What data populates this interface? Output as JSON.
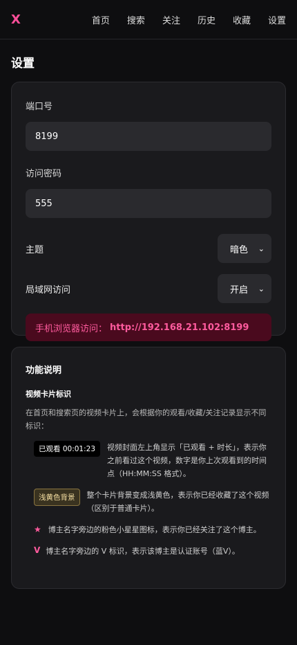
{
  "header": {
    "logo": "X",
    "nav": [
      "首页",
      "搜索",
      "关注",
      "历史",
      "收藏",
      "设置"
    ]
  },
  "page": {
    "title": "设置"
  },
  "settings": {
    "port_label": "端口号",
    "port_value": "8199",
    "password_label": "访问密码",
    "password_value": "555",
    "theme_label": "主题",
    "theme_value": "暗色",
    "lan_label": "局域网访问",
    "lan_value": "开启",
    "lan_prefix": "手机浏览器访问：",
    "lan_url": "http://192.168.21.102:8199"
  },
  "help": {
    "title": "功能说明",
    "section_title": "视频卡片标识",
    "intro": "在首页和搜索页的视频卡片上，会根据你的观看/收藏/关注记录显示不同标识：",
    "items": [
      {
        "badge": "已观看 00:01:23",
        "text": "视频封面左上角显示「已观看 + 时长」，表示你之前看过这个视频，数字是你上次观看到的时间点（HH:MM:SS 格式）。"
      },
      {
        "badge": "浅黄色背景",
        "text": "整个卡片背景变成浅黄色，表示你已经收藏了这个视频（区别于普通卡片）。"
      },
      {
        "badge": "★",
        "text": "博主名字旁边的粉色小星星图标，表示你已经关注了这个博主。"
      },
      {
        "badge": "V",
        "text": "博主名字旁边的 V 标识，表示该博主是认证账号（蓝V）。"
      }
    ]
  },
  "colors": {
    "accent": "#ff4f9a",
    "background": "#0e0e10",
    "card": "#1a1a1d"
  },
  "icons": {
    "select_arrow": "chevron-down-icon",
    "star": "star-icon",
    "verified": "verified-v-icon"
  }
}
